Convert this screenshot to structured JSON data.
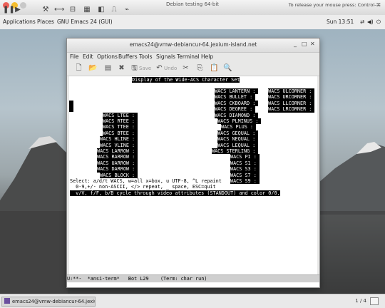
{
  "vm": {
    "title": "Debian testing 64-bit",
    "hint": "To release your mouse press: Control-⌘"
  },
  "panel": {
    "applications": "Applications",
    "places": "Places",
    "app": "GNU Emacs 24 (GUI)",
    "clock": "Sun 13:51"
  },
  "window": {
    "title": "emacs24@vmw-debiancur-64.jexium-island.net",
    "menu": [
      "File",
      "Edit",
      "Options",
      "Buffers",
      "Tools",
      "Signals",
      "Terminal",
      "Help"
    ],
    "toolbar": {
      "save": "Save",
      "undo": "Undo"
    }
  },
  "terminal": {
    "header": "Display of the Wide-ACS Character Set",
    "lines_right": [
      "WACS LANTERN : ",
      "WACS BULLET : ",
      "WACS CKBOARD : ",
      "WACS DEGREE : ",
      "WACS DIAMOND : ",
      "WACS PLMINUS : ",
      "WACS PLUS : ",
      "WACS GEQUAL : ",
      "WACS NEQUAL : ",
      "WACS LEQUAL : ",
      "WACS STERLING : ",
      "WACS PI : ",
      "WACS S1 : ",
      "WACS S3 : ",
      "WACS S7 : ",
      "WACS S9 : "
    ],
    "lines_corners": [
      "WACS ULCORNER : ",
      "WACS URCORNER : ",
      "WACS LLCORNER : ",
      "WACS LRCORNER : "
    ],
    "lines_left": [
      "WACS LTEE : ",
      "WACS RTEE : ",
      "WACS TTEE : ",
      "WACS BTEE : ",
      "WACS HLINE : ",
      "WACS VLINE : ",
      "WACS LARROW : ",
      "WACS RARROW : ",
      "WACS UARROW : ",
      "WACS DARROW : ",
      "WACS BLOCK : "
    ],
    "help": [
      "Select: a/d/t WACS, w=all x=box, u UTF-8, ^L repaint",
      "  0-9,+/- non-ASCII, </> repeat, _ space, ESC=quit",
      "  v/V, f/F, b/B cycle through video attributes (STANDOUT) and color 0/0."
    ]
  },
  "modeline": "U:**-  *ansi-term*   Bot L29    (Term: char run)",
  "taskbar": {
    "task": "emacs24@vmw-debiancur-64.jexiu...",
    "workspace": "1 / 4"
  }
}
